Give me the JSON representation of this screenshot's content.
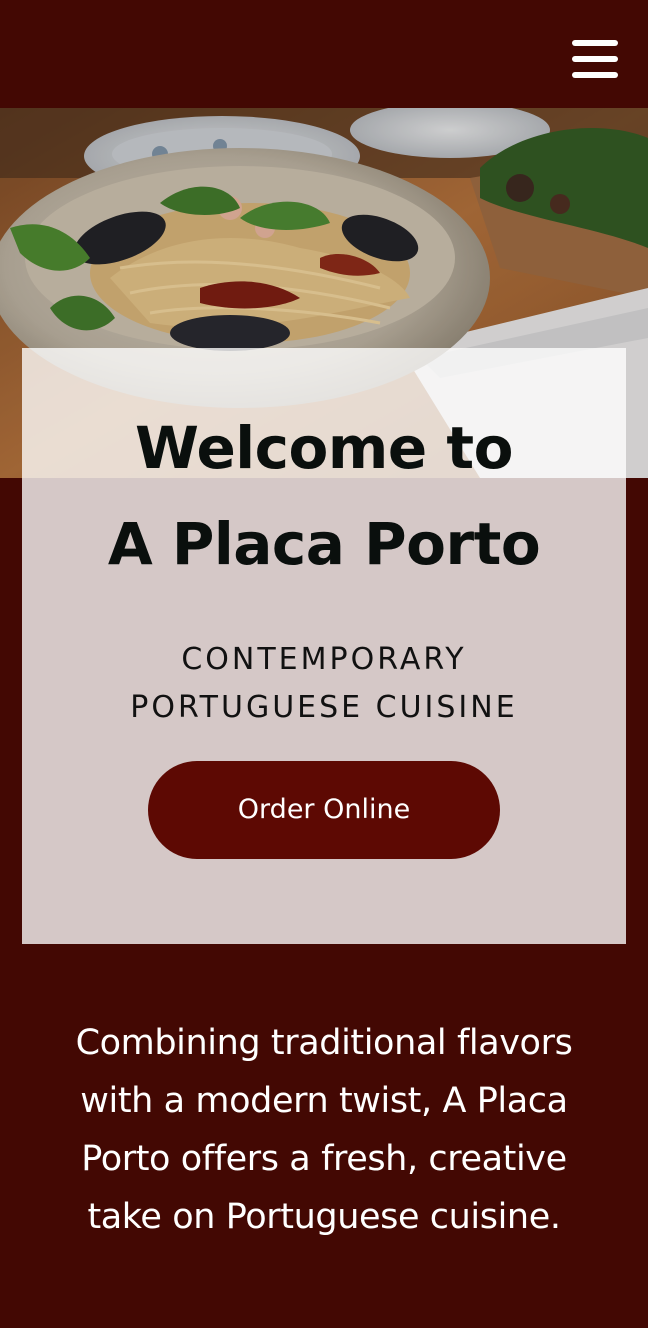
{
  "header": {
    "menu_icon": "hamburger-menu-icon"
  },
  "hero": {
    "image_alt": "plate of seafood spaghetti with herbs"
  },
  "welcome": {
    "title_line1": "Welcome to",
    "title_line2": "A Placa Porto",
    "subtitle_line1": "CONTEMPORARY",
    "subtitle_line2": "PORTUGUESE CUISINE",
    "order_button_label": "Order Online"
  },
  "intro": {
    "lines": [
      "Combining traditional flavors",
      "with a modern twist, A Placa",
      "Porto offers a fresh, creative",
      "take on Portuguese cuisine."
    ]
  },
  "colors": {
    "background": "#430803",
    "button": "#5d0903",
    "card_overlay": "rgba(255,255,255,0.78)"
  }
}
